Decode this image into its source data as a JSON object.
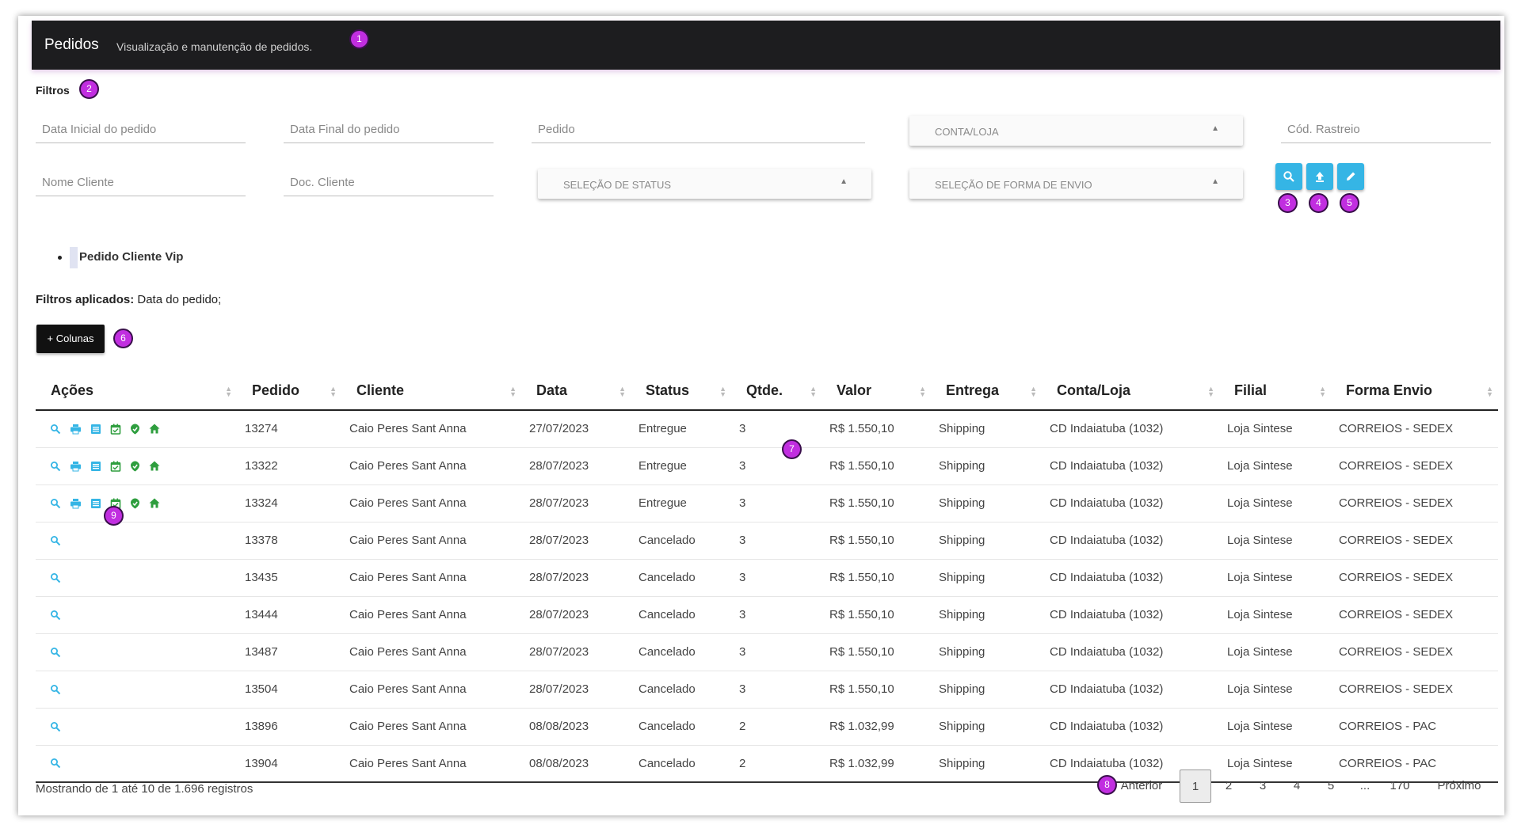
{
  "header": {
    "title": "Pedidos",
    "subtitle": "Visualização e manutenção de pedidos."
  },
  "markers": [
    "1",
    "2",
    "3",
    "4",
    "5",
    "6",
    "7",
    "8",
    "9"
  ],
  "filters": {
    "title": "Filtros",
    "data_inicial_placeholder": "Data Inicial do pedido",
    "data_final_placeholder": "Data Final do pedido",
    "pedido_placeholder": "Pedido",
    "conta_loja_select": "CONTA/LOJA",
    "cod_rastreio_placeholder": "Cód. Rastreio",
    "nome_cliente_placeholder": "Nome Cliente",
    "doc_cliente_placeholder": "Doc. Cliente",
    "status_select": "SELEÇÃO DE STATUS",
    "forma_envio_select": "SELEÇÃO DE FORMA DE ENVIO",
    "buttons": [
      "search-icon",
      "upload-icon",
      "edit-icon"
    ],
    "button_color": "#35b5e5"
  },
  "vip_item": "Pedido Cliente Vip",
  "applied": {
    "label": "Filtros aplicados:",
    "value": "Data do pedido;"
  },
  "columns_button": "+ Colunas",
  "table": {
    "headers": [
      "Ações",
      "Pedido",
      "Cliente",
      "Data",
      "Status",
      "Qtde.",
      "Valor",
      "Entrega",
      "Conta/Loja",
      "Filial",
      "Forma Envio"
    ],
    "rows": [
      {
        "actions": "full",
        "pedido": "13274",
        "cliente": "Caio Peres Sant Anna",
        "data": "27/07/2023",
        "status": "Entregue",
        "qtde": "3",
        "valor": "R$ 1.550,10",
        "entrega": "Shipping",
        "conta": "CD Indaiatuba (1032)",
        "filial": "Loja Sintese",
        "forma": "CORREIOS - SEDEX"
      },
      {
        "actions": "full",
        "pedido": "13322",
        "cliente": "Caio Peres Sant Anna",
        "data": "28/07/2023",
        "status": "Entregue",
        "qtde": "3",
        "valor": "R$ 1.550,10",
        "entrega": "Shipping",
        "conta": "CD Indaiatuba (1032)",
        "filial": "Loja Sintese",
        "forma": "CORREIOS - SEDEX"
      },
      {
        "actions": "full",
        "pedido": "13324",
        "cliente": "Caio Peres Sant Anna",
        "data": "28/07/2023",
        "status": "Entregue",
        "qtde": "3",
        "valor": "R$ 1.550,10",
        "entrega": "Shipping",
        "conta": "CD Indaiatuba (1032)",
        "filial": "Loja Sintese",
        "forma": "CORREIOS - SEDEX"
      },
      {
        "actions": "search",
        "pedido": "13378",
        "cliente": "Caio Peres Sant Anna",
        "data": "28/07/2023",
        "status": "Cancelado",
        "qtde": "3",
        "valor": "R$ 1.550,10",
        "entrega": "Shipping",
        "conta": "CD Indaiatuba (1032)",
        "filial": "Loja Sintese",
        "forma": "CORREIOS - SEDEX"
      },
      {
        "actions": "search",
        "pedido": "13435",
        "cliente": "Caio Peres Sant Anna",
        "data": "28/07/2023",
        "status": "Cancelado",
        "qtde": "3",
        "valor": "R$ 1.550,10",
        "entrega": "Shipping",
        "conta": "CD Indaiatuba (1032)",
        "filial": "Loja Sintese",
        "forma": "CORREIOS - SEDEX"
      },
      {
        "actions": "search",
        "pedido": "13444",
        "cliente": "Caio Peres Sant Anna",
        "data": "28/07/2023",
        "status": "Cancelado",
        "qtde": "3",
        "valor": "R$ 1.550,10",
        "entrega": "Shipping",
        "conta": "CD Indaiatuba (1032)",
        "filial": "Loja Sintese",
        "forma": "CORREIOS - SEDEX"
      },
      {
        "actions": "search",
        "pedido": "13487",
        "cliente": "Caio Peres Sant Anna",
        "data": "28/07/2023",
        "status": "Cancelado",
        "qtde": "3",
        "valor": "R$ 1.550,10",
        "entrega": "Shipping",
        "conta": "CD Indaiatuba (1032)",
        "filial": "Loja Sintese",
        "forma": "CORREIOS - SEDEX"
      },
      {
        "actions": "search",
        "pedido": "13504",
        "cliente": "Caio Peres Sant Anna",
        "data": "28/07/2023",
        "status": "Cancelado",
        "qtde": "3",
        "valor": "R$ 1.550,10",
        "entrega": "Shipping",
        "conta": "CD Indaiatuba (1032)",
        "filial": "Loja Sintese",
        "forma": "CORREIOS - SEDEX"
      },
      {
        "actions": "search",
        "pedido": "13896",
        "cliente": "Caio Peres Sant Anna",
        "data": "08/08/2023",
        "status": "Cancelado",
        "qtde": "2",
        "valor": "R$ 1.032,99",
        "entrega": "Shipping",
        "conta": "CD Indaiatuba (1032)",
        "filial": "Loja Sintese",
        "forma": "CORREIOS - PAC"
      },
      {
        "actions": "search",
        "pedido": "13904",
        "cliente": "Caio Peres Sant Anna",
        "data": "08/08/2023",
        "status": "Cancelado",
        "qtde": "2",
        "valor": "R$ 1.032,99",
        "entrega": "Shipping",
        "conta": "CD Indaiatuba (1032)",
        "filial": "Loja Sintese",
        "forma": "CORREIOS - PAC"
      }
    ],
    "action_icons": [
      "search-icon",
      "print-icon",
      "list-icon",
      "calendar-check-icon",
      "shield-check-icon",
      "home-icon"
    ],
    "action_colors": {
      "blue": "#35b5e5",
      "green": "#2e9e3e"
    }
  },
  "footer": {
    "info": "Mostrando de 1 até 10 de 1.696 registros",
    "prev": "Anterior",
    "pages": [
      "1",
      "2",
      "3",
      "4",
      "5",
      "...",
      "170"
    ],
    "current_page": "1",
    "next": "Próximo"
  }
}
